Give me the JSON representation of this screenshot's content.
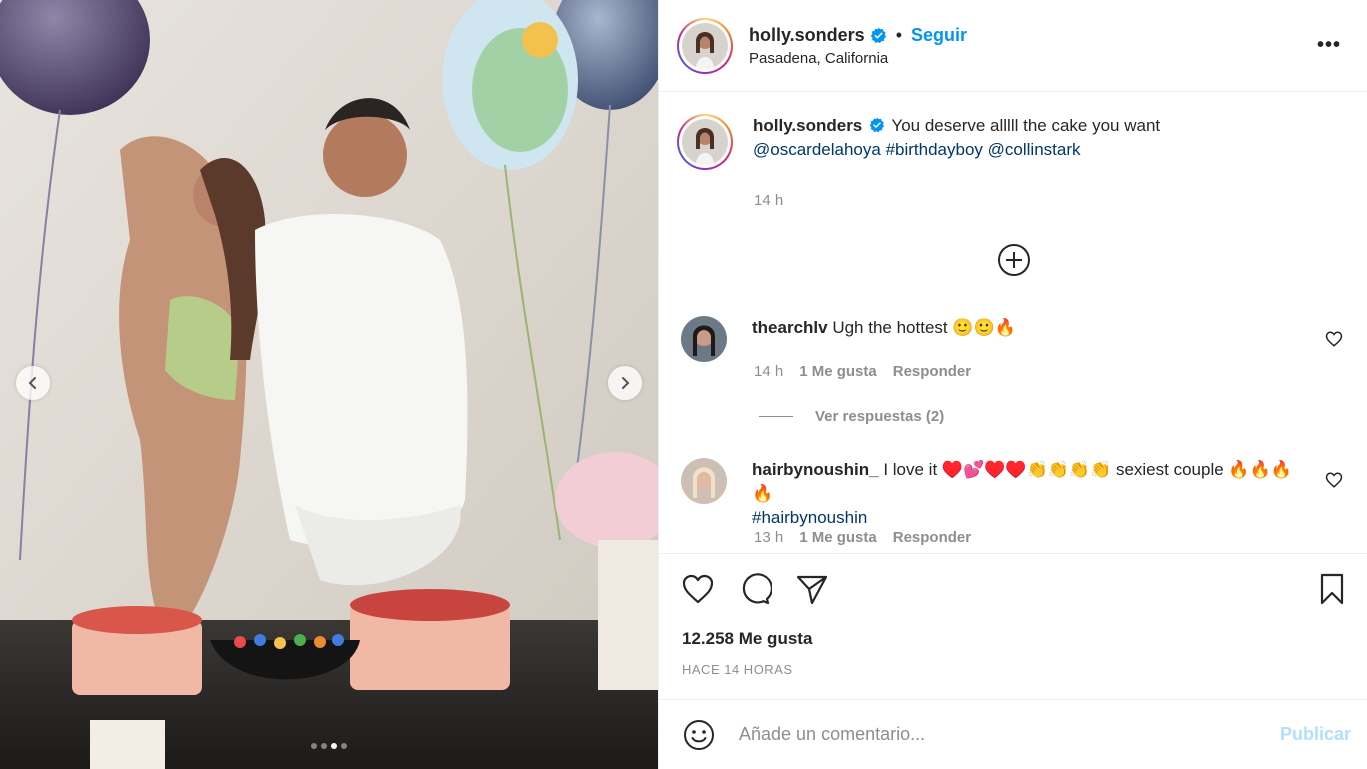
{
  "post": {
    "username": "holly.sonders",
    "separator": "•",
    "follow_label": "Seguir",
    "location": "Pasadena, California",
    "more_label": "•••",
    "caption_text": "You deserve alllll the cake you want",
    "caption_mention1": "@oscardelahoya",
    "caption_hashtag": "#birthdayboy",
    "caption_mention2": "@collinstark",
    "caption_time": "14 h",
    "carousel": {
      "total_slides": 4,
      "active_slide": 3
    }
  },
  "comments": [
    {
      "username": "thearchlv",
      "text": "Ugh the hottest 🙂🙂🔥",
      "time": "14 h",
      "likes": "1 Me gusta",
      "reply": "Responder",
      "view_replies": "Ver respuestas (2)"
    },
    {
      "username": "hairbynoushin_",
      "text": "I love it ♥️💕♥️♥️👏👏👏👏 sexiest couple 🔥🔥🔥🔥",
      "hashtag": "#hairbynoushin",
      "time": "13 h",
      "likes": "1 Me gusta",
      "reply": "Responder"
    }
  ],
  "stats": {
    "likes": "12.258 Me gusta",
    "posted_ago": "HACE 14 HORAS"
  },
  "composer": {
    "placeholder": "Añade un comentario...",
    "publish_label": "Publicar"
  },
  "colors": {
    "accent": "#0095f6",
    "link": "#00376b",
    "muted": "#8e8e8e",
    "publish_disabled": "#b2dffc"
  },
  "icons": [
    "chevron-left-icon",
    "chevron-right-icon",
    "verified-badge-icon",
    "more-options-icon",
    "plus-circle-icon",
    "heart-icon",
    "comment-icon",
    "share-icon",
    "bookmark-icon",
    "emoji-icon"
  ]
}
